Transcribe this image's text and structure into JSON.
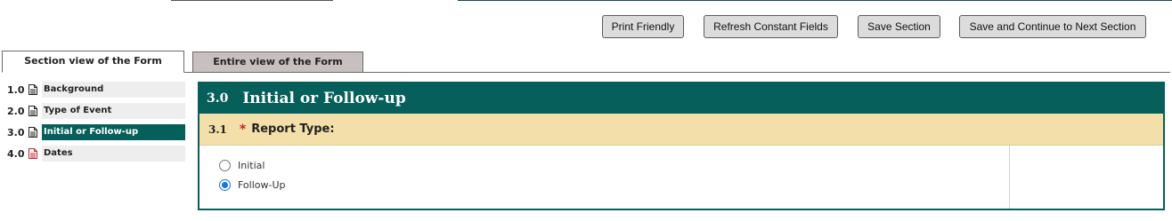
{
  "toolbar": {
    "print_label": "Print Friendly",
    "refresh_label": "Refresh Constant Fields",
    "save_label": "Save Section",
    "continue_label": "Save and Continue to Next Section"
  },
  "tabs": {
    "section_view": "Section view of the Form",
    "entire_view": "Entire view of the Form"
  },
  "sidebar": {
    "items": [
      {
        "number": "1.0",
        "label": "Background",
        "active": false
      },
      {
        "number": "2.0",
        "label": "Type of Event",
        "active": false
      },
      {
        "number": "3.0",
        "label": "Initial or Follow-up",
        "active": true
      },
      {
        "number": "4.0",
        "label": "Dates",
        "active": false
      }
    ]
  },
  "section": {
    "number": "3.0",
    "title": "Initial or Follow-up",
    "question": {
      "number": "3.1",
      "required_mark": "*",
      "label": "Report Type:",
      "options": [
        {
          "label": "Initial",
          "selected": false
        },
        {
          "label": "Follow-Up",
          "selected": true
        }
      ]
    }
  },
  "colors": {
    "accent": "#075f5c",
    "question_bg": "#f2dfaa",
    "required": "#d21d1d",
    "radio_selected": "#1a73e8"
  }
}
